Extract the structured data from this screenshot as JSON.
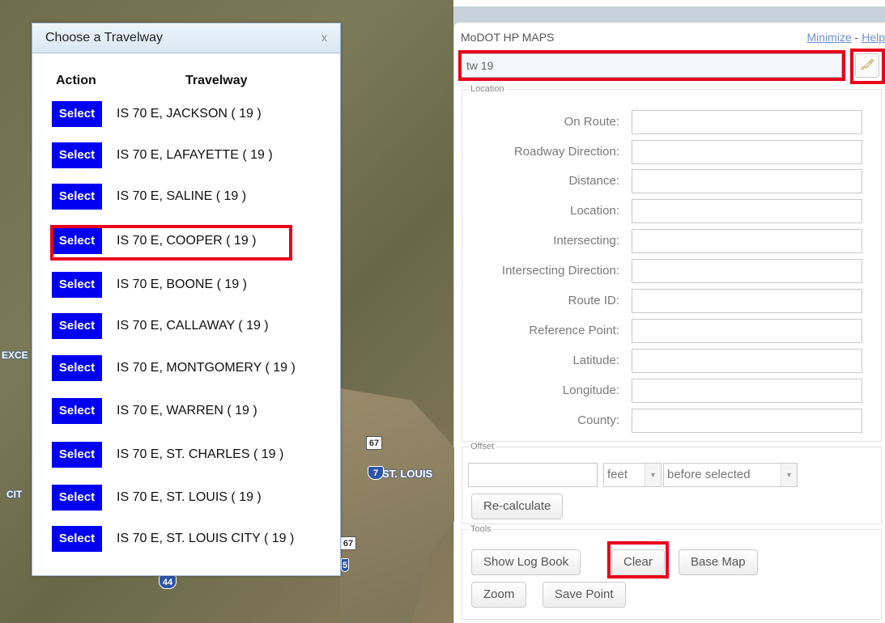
{
  "map": {
    "labels": [
      "EXCE",
      "CIT",
      "ST. LOUIS"
    ],
    "shields": [
      "67",
      "7",
      "67",
      "44",
      "5"
    ]
  },
  "dialog": {
    "title": "Choose a Travelway",
    "close": "x",
    "col_action": "Action",
    "col_travelway": "Travelway",
    "select_label": "Select",
    "rows": [
      "IS 70 E, JACKSON ( 19 )",
      "IS 70 E, LAFAYETTE ( 19 )",
      "IS 70 E, SALINE ( 19 )",
      "IS 70 E, COOPER ( 19 )",
      "IS 70 E, BOONE ( 19 )",
      "IS 70 E, CALLAWAY ( 19 )",
      "IS 70 E, MONTGOMERY ( 19 )",
      "IS 70 E, WARREN ( 19 )",
      "IS 70 E, ST. CHARLES ( 19 )",
      "IS 70 E, ST. LOUIS ( 19 )",
      "IS 70 E, ST. LOUIS CITY ( 19 )"
    ],
    "highlighted_row": "IS 70 E, COOPER ( 19 )"
  },
  "panel": {
    "title": "MoDOT HP MAPS",
    "minimize": "Minimize",
    "separator": " - ",
    "help": "Help",
    "search_value": "tw 19",
    "location": {
      "legend": "Location",
      "fields": [
        "On Route:",
        "Roadway Direction:",
        "Distance:",
        "Location:",
        "Intersecting:",
        "Intersecting Direction:",
        "Route ID:",
        "Reference Point:",
        "Latitude:",
        "Longitude:",
        "County:"
      ]
    },
    "offset": {
      "legend": "Offset",
      "unit": "feet",
      "position": "before selected",
      "recalc": "Re-calculate"
    },
    "tools": {
      "legend": "Tools",
      "show_log": "Show Log Book",
      "clear": "Clear",
      "base_map": "Base Map",
      "zoom": "Zoom",
      "save_point": "Save Point"
    }
  },
  "colors": {
    "select_button": "#0000f0",
    "highlight": "#e8001c",
    "link": "#6b8fd0"
  }
}
